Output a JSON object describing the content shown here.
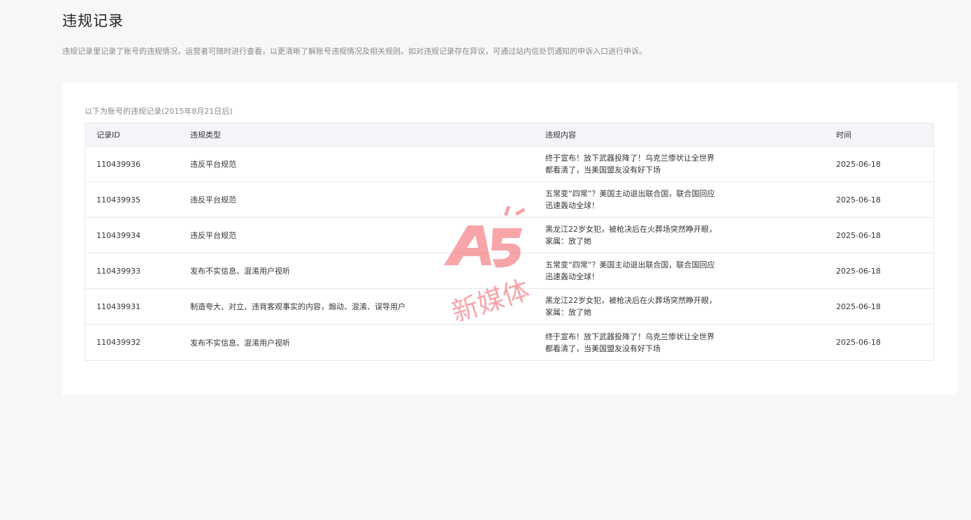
{
  "header": {
    "title": "违规记录",
    "description": "违规记录里记录了账号的违规情况，运营者可随时进行查看，以更清晰了解账号违规情况及相关规则。如对违规记录存在异议，可通过站内信处罚通知的申诉入口进行申诉。"
  },
  "card": {
    "caption": "以下为账号的违规记录(2015年8月21日后)"
  },
  "table": {
    "columns": {
      "id": "记录ID",
      "type": "违规类型",
      "content": "违规内容",
      "time": "时间"
    },
    "rows": [
      {
        "id": "110439936",
        "type": "违反平台规范",
        "content": "终于宣布！放下武器投降了！乌克兰惨状让全世界都看清了，当美国盟友没有好下场",
        "time": "2025-06-18"
      },
      {
        "id": "110439935",
        "type": "违反平台规范",
        "content": "五常变“四常”？美国主动退出联合国，联合国回应迅速轰动全球！",
        "time": "2025-06-18"
      },
      {
        "id": "110439934",
        "type": "违反平台规范",
        "content": "黑龙江22岁女犯，被枪决后在火葬场突然睁开眼，家属：放了她",
        "time": "2025-06-18"
      },
      {
        "id": "110439933",
        "type": "发布不实信息、混淆用户视听",
        "content": "五常变“四常”？美国主动退出联合国，联合国回应迅速轰动全球！",
        "time": "2025-06-18"
      },
      {
        "id": "110439931",
        "type": "制造夸大、对立、违背客观事实的内容，煽动、混淆、误导用户",
        "content": "黑龙江22岁女犯，被枪决后在火葬场突然睁开眼，家属：放了她",
        "time": "2025-06-18"
      },
      {
        "id": "110439932",
        "type": "发布不实信息、混淆用户视听",
        "content": "终于宣布！放下武器投降了！乌克兰惨状让全世界都看清了，当美国盟友没有好下场",
        "time": "2025-06-18"
      }
    ]
  },
  "watermark": {
    "logo_text": "A5",
    "sub_text": "新媒体",
    "color": "#f25c64"
  }
}
